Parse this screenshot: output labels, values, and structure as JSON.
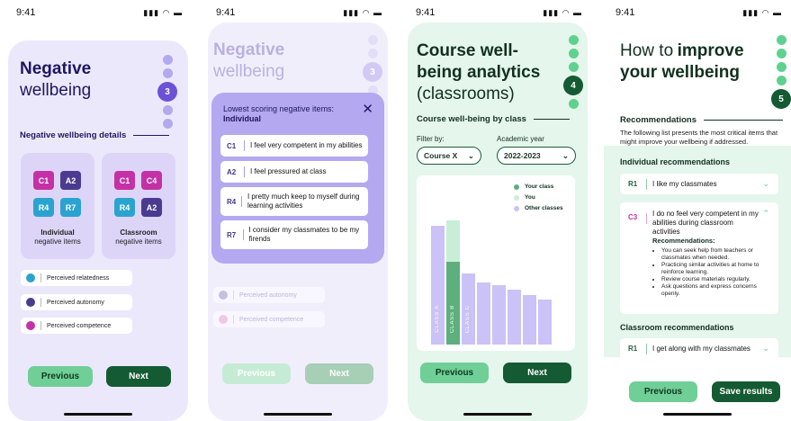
{
  "status_time": "9:41",
  "screen1": {
    "title_bold": "Negative",
    "title_regular": "wellbeing",
    "step_number": "3",
    "section_heading": "Negative wellbeing details",
    "individual": {
      "tiles": [
        "C1",
        "A2",
        "R4",
        "R7"
      ],
      "label_bold": "Individual",
      "label_sub": "negative items"
    },
    "classroom": {
      "tiles": [
        "C1",
        "C4",
        "R4",
        "A2"
      ],
      "label_bold": "Classroom",
      "label_sub": "negative items"
    },
    "legend": [
      "Perceived relatedness",
      "Perceived autonomy",
      "Perceived competence"
    ],
    "previous_label": "Previous",
    "next_label": "Next",
    "colors": {
      "card": "#ece8fb",
      "relatedness": "#2aa4cf",
      "autonomy": "#4b3a8f",
      "competence": "#c431a6"
    }
  },
  "screen2": {
    "title_bold": "Negative",
    "title_regular": "wellbeing",
    "step_number": "3",
    "modal_title": "Lowest scoring negative items:",
    "modal_subtitle": "Individual",
    "items": [
      {
        "code": "C1",
        "text": "I feel very competent in my abilities"
      },
      {
        "code": "A2",
        "text": "I feel pressured at class"
      },
      {
        "code": "R4",
        "text": "I pretty much keep to myself during learning activities"
      },
      {
        "code": "R7",
        "text": "I consider my classmates to be my firends"
      }
    ],
    "legend": [
      "Perceived autonomy",
      "Perceived competence"
    ],
    "previous_label": "Previous",
    "next_label": "Next"
  },
  "screen3": {
    "title_bold": "Course well-being analytics",
    "title_regular": "(classrooms)",
    "step_number": "4",
    "section_heading": "Course well-being by class",
    "filter_label": "Filter by:",
    "filter_value": "Course X",
    "year_label": "Academic year",
    "year_value": "2022-2023",
    "legend": [
      "Your class",
      "You",
      "Other classes"
    ],
    "previous_label": "Previous",
    "next_label": "Next"
  },
  "chart_data": {
    "type": "bar",
    "categories": [
      "CLASS A",
      "CLASS B",
      "CLASS C",
      "",
      "",
      "",
      "",
      ""
    ],
    "series": [
      {
        "name": "Other classes",
        "values": [
          100,
          0,
          0,
          0,
          0,
          0,
          0,
          0
        ]
      },
      {
        "name": "Your class",
        "values": [
          0,
          70,
          0,
          0,
          0,
          0,
          0,
          0
        ]
      },
      {
        "name": "You",
        "values": [
          0,
          35,
          0,
          0,
          0,
          0,
          0,
          0
        ]
      },
      {
        "name": "Other classes",
        "values": [
          0,
          0,
          60,
          52,
          50,
          46,
          42,
          38
        ]
      }
    ],
    "ylim": [
      0,
      110
    ],
    "legend_position": "top-right",
    "colors": {
      "Your class": "#5daf7e",
      "You": "#c9eed8",
      "Other classes": "#cbc2f7"
    }
  },
  "screen4": {
    "title_regular": "How to",
    "title_bold": "improve",
    "title_bold2": "your wellbeing",
    "step_number": "5",
    "section_heading": "Recommendations",
    "intro": "The following list presents the most critical items that might improve your wellbeing if addressed.",
    "individual_heading": "Individual recommendations",
    "items": [
      {
        "code": "R1",
        "text": "I like my classmates"
      },
      {
        "code": "C3",
        "text": "I do no feel very competent in my abilities during classroom activities"
      }
    ],
    "recommendations_title": "Recommendations",
    "recommendations": [
      "You can seek help from teachers or classmates when needed.",
      "Practicing similar activities at home to reinforce learning.",
      "Review course materials regularly.",
      "Ask questions and express concerns openly."
    ],
    "classroom_heading": "Classroom recommendations",
    "classroom_item": {
      "code": "R1",
      "text": "I get along with my classmates"
    },
    "previous_label": "Previous",
    "save_label": "Save results"
  }
}
